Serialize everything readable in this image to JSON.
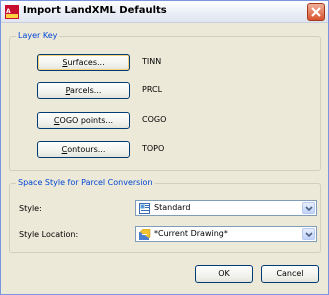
{
  "window": {
    "title": "Import LandXML Defaults",
    "app_icon": "autocad-icon",
    "close_icon": "close-icon"
  },
  "layer_key": {
    "group_label": "Layer Key",
    "rows": [
      {
        "button_underline": "S",
        "button_rest": "urfaces...",
        "value": "TINN"
      },
      {
        "button_underline": "P",
        "button_rest": "arcels...",
        "value": "PRCL"
      },
      {
        "button_underline": "C",
        "button_rest": "OGO points...",
        "value": "COGO"
      },
      {
        "button_underline": "C",
        "button_rest": "ontours...",
        "value": "TOPO"
      }
    ]
  },
  "space_style": {
    "group_label": "Space Style for Parcel Conversion",
    "style_label": "Style:",
    "style_value": "Standard",
    "style_icon": "style-icon",
    "location_label": "Style Location:",
    "location_value": "*Current Drawing*",
    "location_icon": "drawing-icon"
  },
  "footer": {
    "ok_label": "OK",
    "cancel_label": "Cancel"
  },
  "colors": {
    "group_label": "#0046d5",
    "dialog_bg": "#ece9d8",
    "close_button": "#d8532f"
  }
}
